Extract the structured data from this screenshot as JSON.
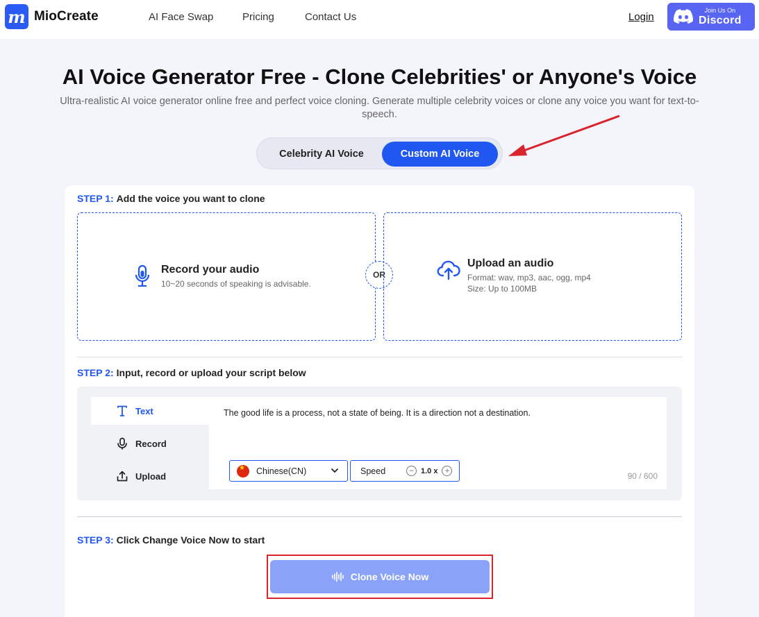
{
  "header": {
    "brand": "MioCreate",
    "logo_letter": "m",
    "nav": [
      "AI Face Swap",
      "Pricing",
      "Contact Us"
    ],
    "login": "Login",
    "discord_small": "Join Us On",
    "discord_big": "Discord"
  },
  "hero": {
    "title": "AI Voice Generator Free - Clone Celebrities' or Anyone's Voice",
    "subtitle": "Ultra-realistic AI voice generator online free and perfect voice cloning. Generate multiple celebrity voices or clone any voice you want for text-to-speech.",
    "tabs": [
      "Celebrity AI Voice",
      "Custom AI Voice"
    ],
    "active_tab": "Custom AI Voice"
  },
  "step1": {
    "label": "STEP 1:",
    "text": "Add the voice you want to clone",
    "record_title": "Record your audio",
    "record_desc": "10~20 seconds of speaking is advisable.",
    "or": "OR",
    "upload_title": "Upload an audio",
    "upload_format": "Format: wav, mp3, aac, ogg, mp4",
    "upload_size": "Size: Up to 100MB"
  },
  "step2": {
    "label": "STEP 2:",
    "text": "Input, record or upload your script below",
    "side": [
      "Text",
      "Record",
      "Upload"
    ],
    "active_side": "Text",
    "script": "The good life is a process, not a state of being. It is a direction not a destination.",
    "language": "Chinese(CN)",
    "speed_label": "Speed",
    "speed_value": "1.0 x",
    "counter": "90 / 600"
  },
  "step3": {
    "label": "STEP 3:",
    "text": "Click Change Voice Now to start",
    "button": "Clone Voice Now"
  },
  "colors": {
    "primary": "#1f57f0",
    "discord": "#5865f2",
    "button_disabled": "#8aa2f7",
    "highlight_red": "#d9232d"
  }
}
